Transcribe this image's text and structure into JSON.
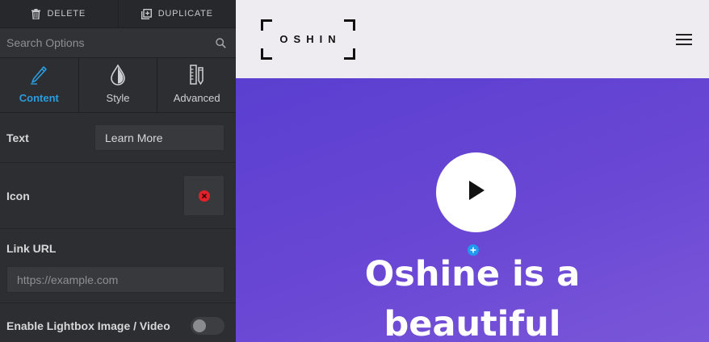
{
  "toolbar": {
    "delete_label": "DELETE",
    "duplicate_label": "DUPLICATE",
    "delete_icon": "trash-icon",
    "duplicate_icon": "duplicate-icon"
  },
  "search": {
    "placeholder": "Search Options",
    "icon": "search-icon"
  },
  "tabs": [
    {
      "label": "Content",
      "icon": "pencil-icon",
      "active": true
    },
    {
      "label": "Style",
      "icon": "drop-icon",
      "active": false
    },
    {
      "label": "Advanced",
      "icon": "ruler-icon",
      "active": false
    }
  ],
  "fields": {
    "text": {
      "label": "Text",
      "value": "Learn More"
    },
    "icon": {
      "label": "Icon",
      "remove_icon": "remove-icon"
    },
    "link": {
      "label": "Link URL",
      "placeholder": "https://example.com"
    },
    "lightbox": {
      "label": "Enable Lightbox Image / Video",
      "enabled": false
    }
  },
  "preview": {
    "logo_text": "OSHIN",
    "menu_icon": "hamburger-menu-icon",
    "play_icon": "play-icon",
    "add_icon": "plus-icon",
    "hero_line1": "Oshine is a",
    "hero_line2": "beautiful"
  },
  "colors": {
    "accent": "#2a9de0",
    "hero_bg": "#5e42d2",
    "remove": "#e4202a"
  }
}
